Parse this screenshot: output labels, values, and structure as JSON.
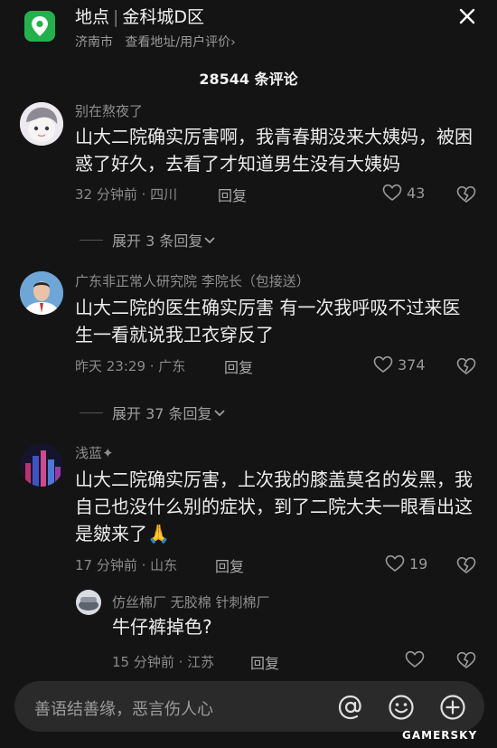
{
  "header": {
    "location_label": "地点",
    "location_name": "金科城D区",
    "city": "济南市",
    "view_link": "查看地址/用户评价",
    "chevron": "›"
  },
  "comment_count": "28544 条评论",
  "comments": [
    {
      "username": "别在熬夜了",
      "text": "山大二院确实厉害啊，我青春期没来大姨妈，被困惑了好久，去看了才知道男生没有大姨妈",
      "meta": "32 分钟前 · 四川",
      "reply_label": "回复",
      "likes": "43",
      "expand_label": "展开 3 条回复"
    },
    {
      "username": "广东非正常人研究院 李院长（包接送）",
      "text": "山大二院的医生确实厉害 有一次我呼吸不过来医生一看就说我卫衣穿反了",
      "meta": "昨天 23:29 · 广东",
      "reply_label": "回复",
      "likes": "374",
      "expand_label": "展开 37 条回复"
    },
    {
      "username": "浅蓝✦",
      "text": "山大二院确实厉害，上次我的膝盖莫名的发黑，我自己也没什么别的症状，到了二院大夫一眼看出这是皴来了🙏",
      "meta": "17 分钟前 · 山东",
      "reply_label": "回复",
      "likes": "19"
    }
  ],
  "reply": {
    "username": "仿丝棉厂 无胶棉  针刺棉厂",
    "text": "牛仔裤掉色?",
    "meta": "15 分钟前 · 江苏",
    "reply_label": "回复"
  },
  "input": {
    "placeholder": "善语结善缘，恶言伤人心"
  },
  "icons": {
    "location": "location-pin-icon",
    "close": "close-icon",
    "like": "heart-icon",
    "dislike": "broken-heart-icon",
    "expand": "chevron-down-icon",
    "mention": "at-icon",
    "emoji": "emoji-icon",
    "add": "plus-circle-icon"
  },
  "colors": {
    "background": "#141414",
    "accent_green": "#22b24c",
    "text_primary": "#ececec",
    "text_secondary": "#8a8a8a"
  },
  "watermark": "GAMERSKY"
}
